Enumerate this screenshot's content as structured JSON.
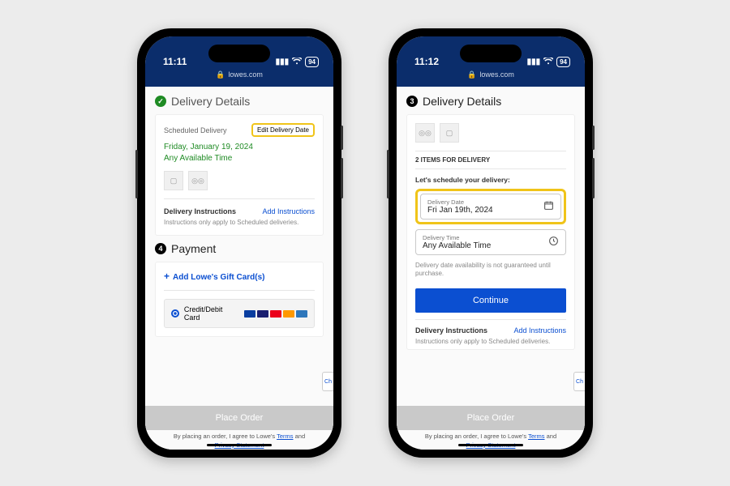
{
  "left": {
    "status": {
      "time": "11:11",
      "battery": "94"
    },
    "url": "lowes.com",
    "delivery": {
      "title": "Delivery Details",
      "scheduled_label": "Scheduled Delivery",
      "edit_link": "Edit Delivery Date",
      "date_line": "Friday, January 19, 2024",
      "time_line": "Any Available Time",
      "instructions_label": "Delivery Instructions",
      "add_instructions": "Add Instructions",
      "instructions_note": "Instructions only apply to Scheduled deliveries."
    },
    "payment": {
      "step": "4",
      "title": "Payment",
      "gift_card": "Add Lowe's Gift Card(s)",
      "credit_label": "Credit/Debit Card"
    },
    "place_order": "Place Order",
    "terms_prefix": "By placing an order, I agree to Lowe's",
    "terms_word": "Terms",
    "terms_and": "and",
    "privacy": "Privacy Statement",
    "chat_tab": "Ch"
  },
  "right": {
    "status": {
      "time": "11:12",
      "battery": "94"
    },
    "url": "lowes.com",
    "delivery": {
      "step": "3",
      "title": "Delivery Details",
      "items_line": "2 ITEMS FOR DELIVERY",
      "schedule_prompt": "Let's schedule your delivery:",
      "date_label": "Delivery Date",
      "date_value": "Fri Jan 19th, 2024",
      "time_label": "Delivery Time",
      "time_value": "Any Available Time",
      "availability_note": "Delivery date availability is not guaranteed until purchase.",
      "continue": "Continue",
      "instructions_label": "Delivery Instructions",
      "add_instructions": "Add Instructions",
      "instructions_note": "Instructions only apply to Scheduled deliveries."
    },
    "place_order": "Place Order",
    "terms_prefix": "By placing an order, I agree to Lowe's",
    "terms_word": "Terms",
    "terms_and": "and",
    "privacy": "Privacy Statement",
    "chat_tab": "Ch"
  }
}
